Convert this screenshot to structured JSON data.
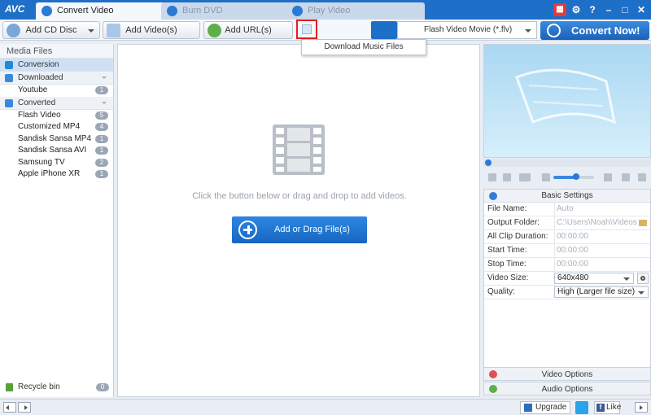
{
  "app": {
    "logo": "AVC",
    "tabs": [
      {
        "label": "Convert Video"
      },
      {
        "label": "Burn DVD"
      },
      {
        "label": "Play Video"
      }
    ]
  },
  "toolbar": {
    "add_cd_label": "Add CD Disc",
    "add_videos_label": "Add Video(s)",
    "add_url_label": "Add URL(s)",
    "format_selected": "Flash Video Movie (*.flv)",
    "convert_now_label": "Convert Now!"
  },
  "menu": {
    "items": [
      {
        "label": "Download Music Files"
      }
    ]
  },
  "sidebar": {
    "header": "Media Files",
    "conversion": "Conversion",
    "downloaded": {
      "label": "Downloaded",
      "items": [
        {
          "label": "Youtube",
          "count": "1"
        }
      ]
    },
    "converted": {
      "label": "Converted",
      "items": [
        {
          "label": "Flash Video",
          "count": "5"
        },
        {
          "label": "Customized MP4",
          "count": "4"
        },
        {
          "label": "Sandisk Sansa MP4",
          "count": "1"
        },
        {
          "label": "Sandisk Sansa AVI",
          "count": "1"
        },
        {
          "label": "Samsung TV",
          "count": "2"
        },
        {
          "label": "Apple iPhone XR",
          "count": "1"
        }
      ]
    },
    "recycle": {
      "label": "Recycle bin",
      "count": "0"
    }
  },
  "main": {
    "hint": "Click the button below or drag and drop to add videos.",
    "add_button": "Add or Drag File(s)"
  },
  "player": {
    "volume_fraction": 0.55
  },
  "settings": {
    "header": "Basic Settings",
    "rows": [
      {
        "key": "File Name:",
        "value": "Auto"
      },
      {
        "key": "Output Folder:",
        "value": "C:\\Users\\Noah\\Videos\\..."
      },
      {
        "key": "All Clip Duration:",
        "value": "00:00:00"
      },
      {
        "key": "Start Time:",
        "value": "00:00:00"
      },
      {
        "key": "Stop Time:",
        "value": "00:00:00"
      },
      {
        "key": "Video Size:",
        "value": "640x480"
      },
      {
        "key": "Quality:",
        "value": "High (Larger file size)"
      }
    ],
    "video_options": "Video Options",
    "audio_options": "Audio Options"
  },
  "statusbar": {
    "upgrade": "Upgrade",
    "like": "Like"
  },
  "colors": {
    "accent": "#1e6fc8",
    "highlight_border": "#e02020",
    "convert_button": "#1a62b8"
  }
}
